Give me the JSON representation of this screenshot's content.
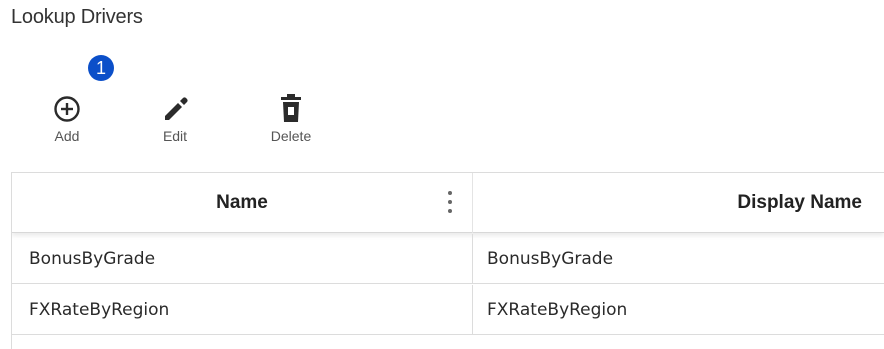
{
  "page": {
    "title": "Lookup Drivers"
  },
  "badge": {
    "text": "1",
    "color": "#0b4fc9"
  },
  "toolbar": {
    "add": {
      "label": "Add",
      "icon": "plus-circle-icon"
    },
    "edit": {
      "label": "Edit",
      "icon": "pencil-icon"
    },
    "delete": {
      "label": "Delete",
      "icon": "trash-icon"
    }
  },
  "grid": {
    "columns": [
      {
        "label": "Name"
      },
      {
        "label": "Display Name"
      }
    ],
    "rows": [
      {
        "name": "BonusByGrade",
        "display_name": "BonusByGrade"
      },
      {
        "name": "FXRateByRegion",
        "display_name": "FXRateByRegion"
      }
    ]
  }
}
